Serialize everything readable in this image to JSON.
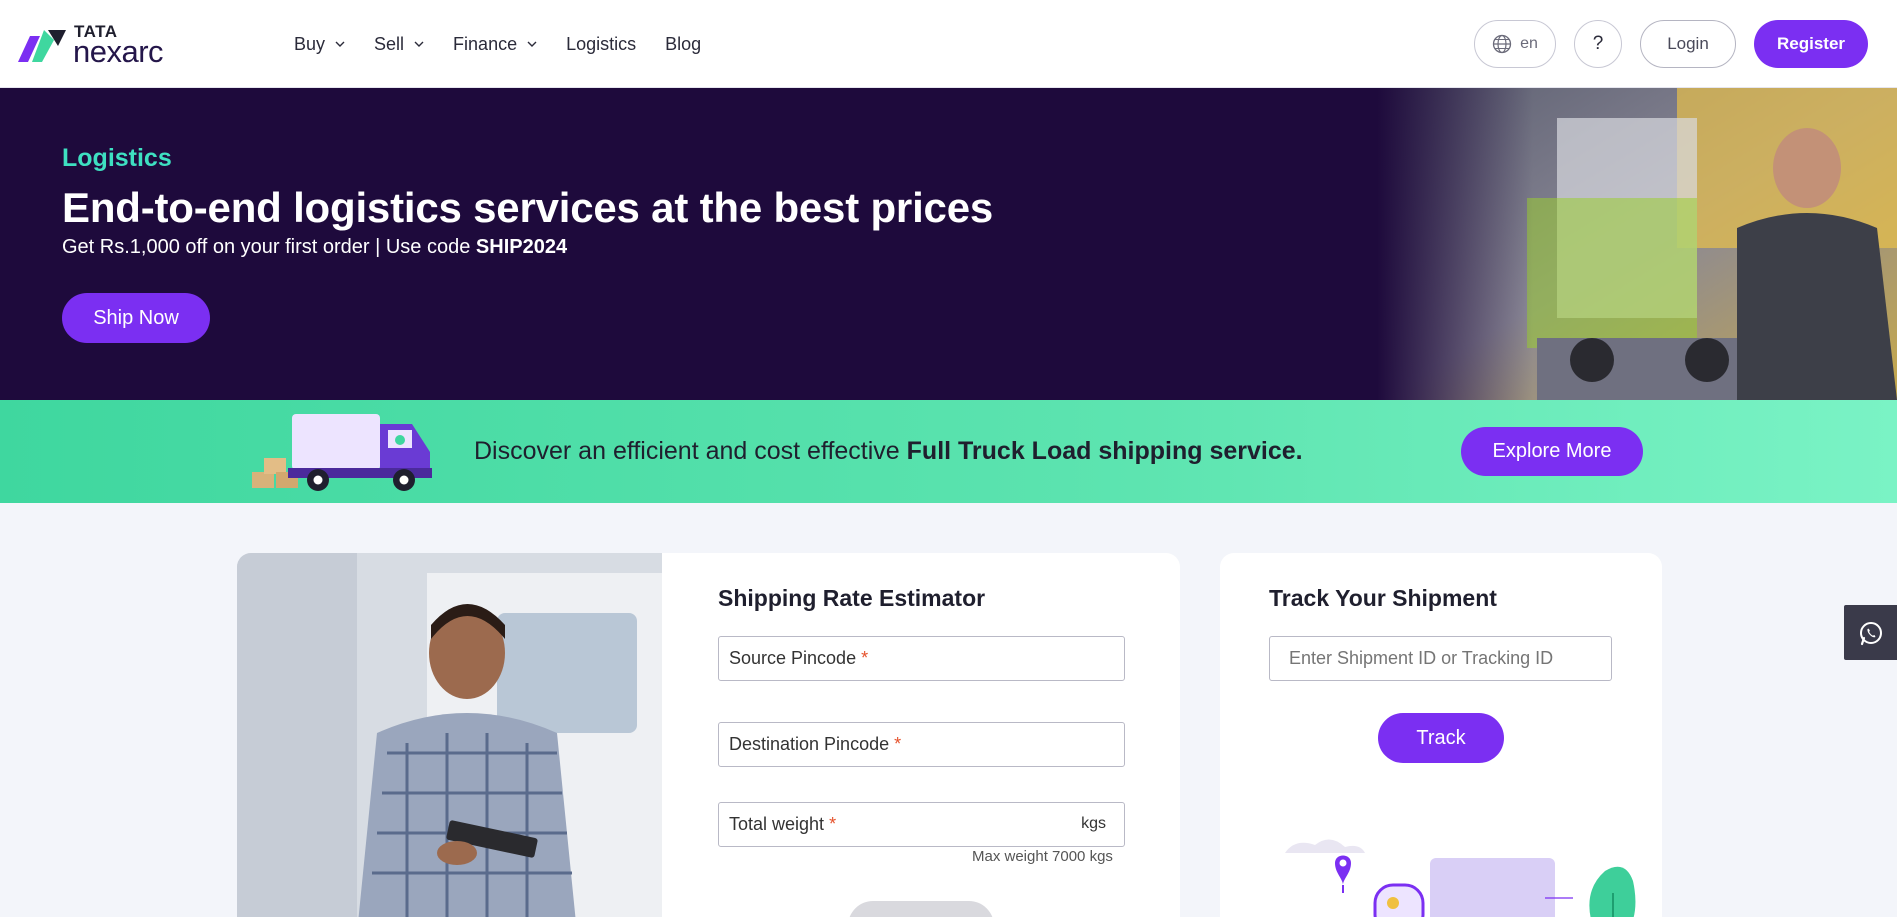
{
  "brand": {
    "top": "TATA",
    "bottom": "nexarc"
  },
  "nav": [
    {
      "label": "Buy",
      "dropdown": true
    },
    {
      "label": "Sell",
      "dropdown": true
    },
    {
      "label": "Finance",
      "dropdown": true
    },
    {
      "label": "Logistics",
      "dropdown": false
    },
    {
      "label": "Blog",
      "dropdown": false
    }
  ],
  "header": {
    "language": "en",
    "help_label": "?",
    "login_label": "Login",
    "register_label": "Register"
  },
  "hero": {
    "eyebrow": "Logistics",
    "title": "End-to-end logistics services at the best prices",
    "subtitle_prefix": "Get Rs.1,000 off on your first order | Use code ",
    "promo_code": "SHIP2024",
    "cta": "Ship Now"
  },
  "promo": {
    "text_prefix": "Discover an efficient and cost effective ",
    "text_bold": "Full Truck Load shipping service.",
    "cta": "Explore More"
  },
  "estimator": {
    "title": "Shipping Rate Estimator",
    "fields": [
      {
        "label": "Source Pincode",
        "required": "*"
      },
      {
        "label": "Destination Pincode",
        "required": "*"
      },
      {
        "label": "Total weight",
        "required": "*",
        "unit": "kgs"
      }
    ],
    "max_weight_hint": "Max weight 7000 kgs"
  },
  "tracker": {
    "title": "Track Your Shipment",
    "input_placeholder": "Enter Shipment ID or Tracking ID",
    "button": "Track"
  },
  "colors": {
    "primary": "#7b2ff2",
    "hero_bg": "#1e0a3c",
    "accent_teal": "#3ee0c1",
    "promo_green": "#4ddba8"
  },
  "icons": {
    "language": "globe-icon",
    "whatsapp": "whatsapp-icon",
    "dropdown": "chevron-down-icon"
  }
}
